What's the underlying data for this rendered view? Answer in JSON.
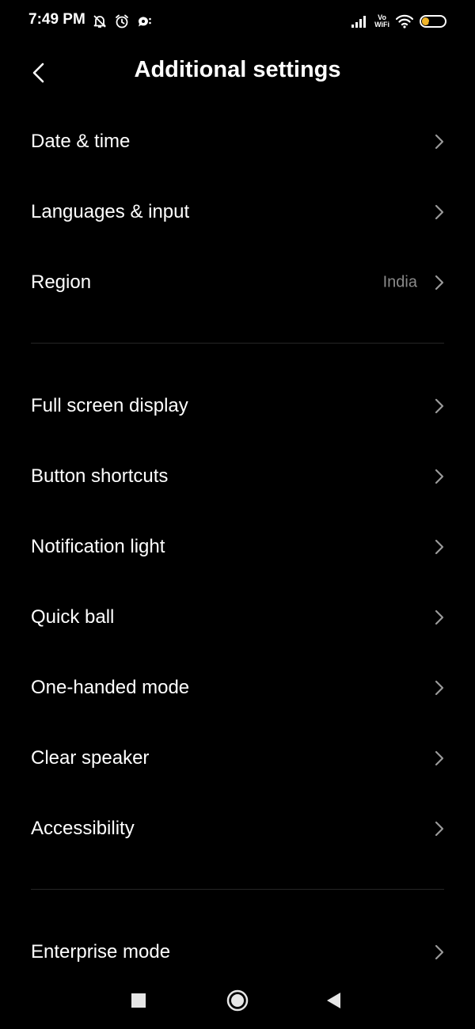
{
  "status_bar": {
    "time": "7:49 PM",
    "left_icons": [
      "bell-muted-icon",
      "alarm-icon",
      "chat-notification-icon"
    ],
    "right_icons": [
      "signal-icon",
      "vowifi-icon",
      "wifi-icon",
      "battery-icon"
    ],
    "volte_top": "Vo",
    "volte_bottom": "WiFi",
    "battery_level": "37",
    "battery_color": "#f0b429"
  },
  "header": {
    "title": "Additional settings",
    "back_icon": "back-chevron-icon"
  },
  "sections": [
    {
      "items": [
        {
          "label": "Date & time",
          "value": ""
        },
        {
          "label": "Languages & input",
          "value": ""
        },
        {
          "label": "Region",
          "value": "India"
        }
      ]
    },
    {
      "items": [
        {
          "label": "Full screen display",
          "value": ""
        },
        {
          "label": "Button shortcuts",
          "value": ""
        },
        {
          "label": "Notification light",
          "value": ""
        },
        {
          "label": "Quick ball",
          "value": ""
        },
        {
          "label": "One-handed mode",
          "value": ""
        },
        {
          "label": "Clear speaker",
          "value": ""
        },
        {
          "label": "Accessibility",
          "value": ""
        }
      ]
    },
    {
      "items": [
        {
          "label": "Enterprise mode",
          "value": ""
        }
      ]
    }
  ],
  "nav_bar": {
    "buttons": [
      "recents-square-icon",
      "home-circle-icon",
      "back-triangle-icon"
    ]
  },
  "colors": {
    "background": "#000000",
    "text_primary": "#ffffff",
    "text_secondary": "#8a8a8a",
    "chevron": "#9a9a9a",
    "divider": "#262626"
  }
}
